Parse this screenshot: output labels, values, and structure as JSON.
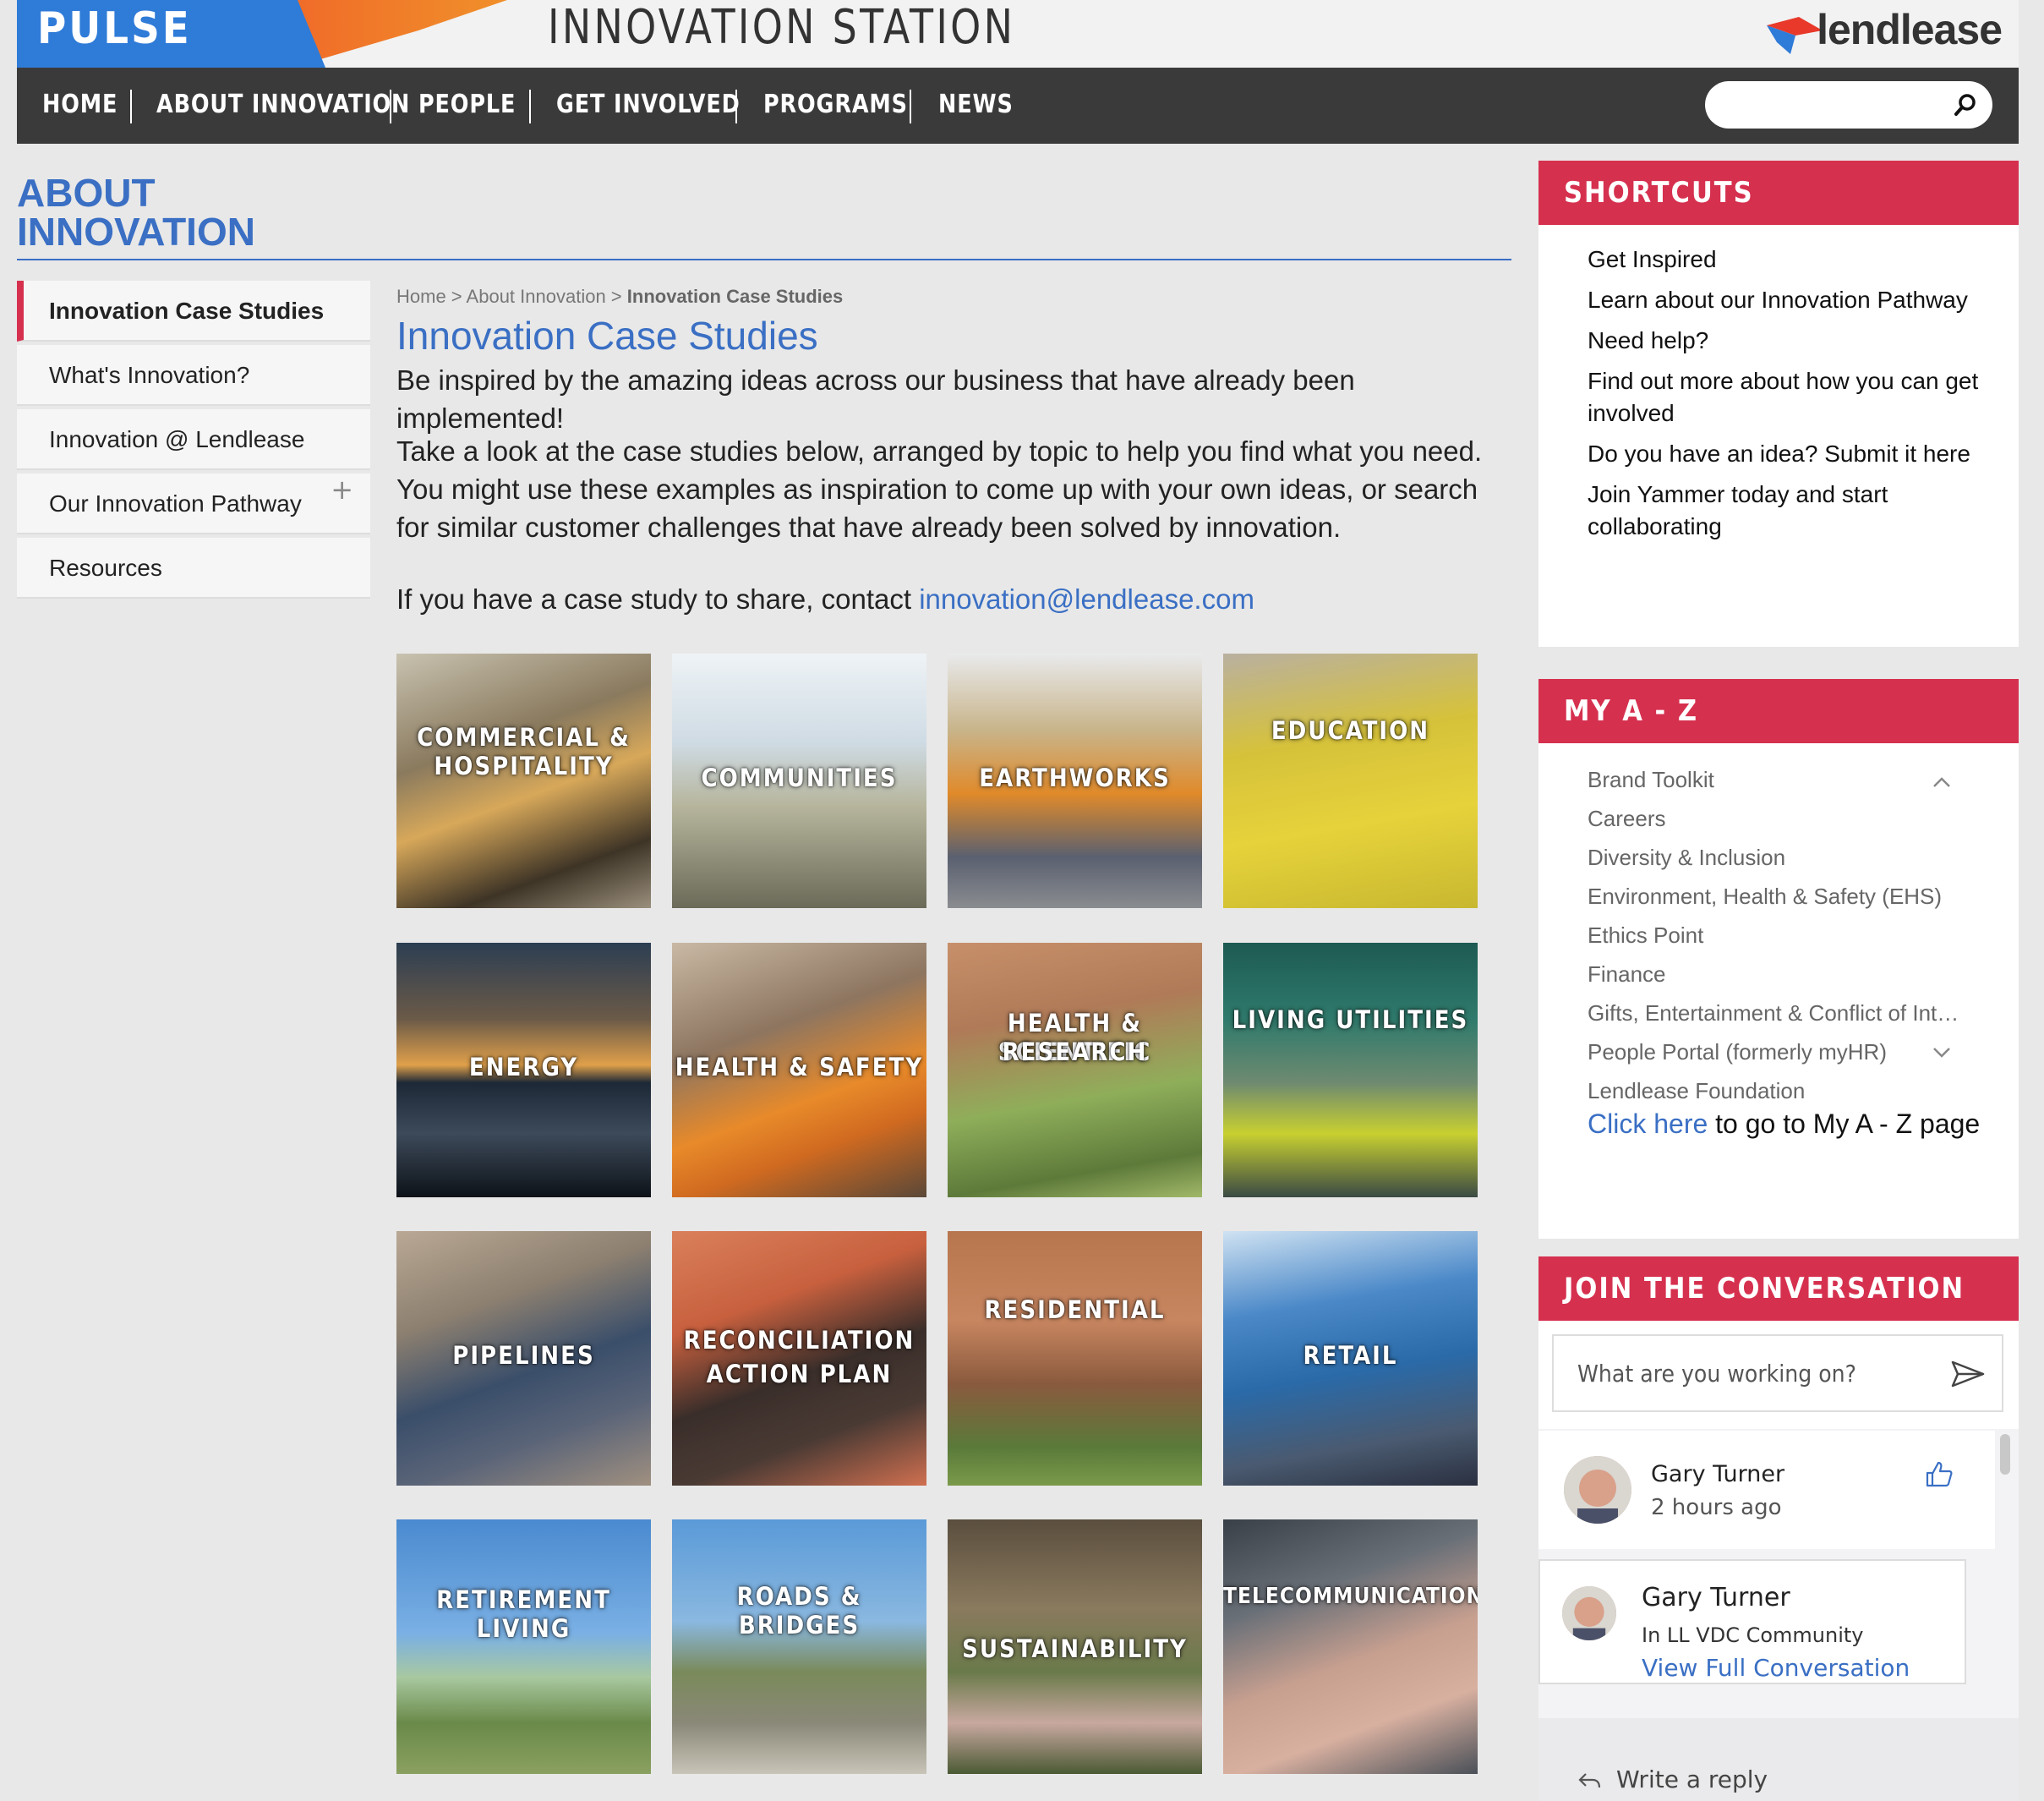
{
  "header": {
    "pulse": "PULSE",
    "site_title": "INNOVATION STATION",
    "brand": "lendlease"
  },
  "nav": {
    "items": [
      "HOME",
      "ABOUT INNOVATION",
      "PEOPLE",
      "GET INVOLVED",
      "PROGRAMS",
      "NEWS"
    ],
    "search_placeholder": ""
  },
  "section": {
    "title_line1": "ABOUT",
    "title_line2": "INNOVATION"
  },
  "leftnav": {
    "items": [
      {
        "label": "Innovation Case Studies",
        "active": true
      },
      {
        "label": "What's Innovation?"
      },
      {
        "label": "Innovation @ Lendlease"
      },
      {
        "label": "Our Innovation Pathway",
        "expand": "+"
      },
      {
        "label": "Resources"
      }
    ]
  },
  "breadcrumb": {
    "home": "Home",
    "sep1": " > ",
    "about": "About Innovation",
    "sep2": " > ",
    "current": "Innovation Case Studies"
  },
  "main": {
    "title": "Innovation Case Studies",
    "intro": "Be inspired by the amazing ideas across our business that have already been implemented!",
    "body": "Take a look at the case studies below, arranged by topic to help you find what you need. You might use these examples as inspiration to come up with your own ideas, or search for similar customer challenges that have already been solved by innovation.",
    "share_prefix": "If you have a case study to share, contact ",
    "share_email": "innovation@lendlease.com"
  },
  "tiles": [
    {
      "line1": "COMMERCIAL &",
      "line2": "HOSPITALITY"
    },
    {
      "line1": "COMMUNITIES",
      "line2": ""
    },
    {
      "line1": "EARTHWORKS",
      "line2": ""
    },
    {
      "line1": "EDUCATION",
      "line2": ""
    },
    {
      "line1": "ENERGY",
      "line2": ""
    },
    {
      "line1": "HEALTH & SAFETY",
      "line2": ""
    },
    {
      "line1": "HEALTH & SCIENTIFIC",
      "line2": "RESEARCH"
    },
    {
      "line1": "LIVING UTILITIES",
      "line2": ""
    },
    {
      "line1": "PIPELINES",
      "line2": ""
    },
    {
      "line1": "RECONCILIATION",
      "line2": "ACTION PLAN"
    },
    {
      "line1": "RESIDENTIAL",
      "line2": ""
    },
    {
      "line1": "RETAIL",
      "line2": ""
    },
    {
      "line1": "RETIREMENT",
      "line2": "LIVING"
    },
    {
      "line1": "ROADS & BRIDGES",
      "line2": ""
    },
    {
      "line1": "SUSTAINABILITY",
      "line2": ""
    },
    {
      "line1": "TELECOMMUNICATIONS",
      "line2": ""
    }
  ],
  "shortcuts": {
    "title": "SHORTCUTS",
    "items": [
      "Get Inspired",
      "Learn about our Innovation Pathway",
      "Need help?",
      "Find out more about how you can get involved",
      "Do you have an idea? Submit it here",
      "Join Yammer today and start collaborating"
    ]
  },
  "az": {
    "title": "MY A - Z",
    "items": [
      "Brand Toolkit",
      "Careers",
      "Diversity & Inclusion",
      "Environment, Health & Safety (EHS)",
      "Ethics Point",
      "Finance",
      "Gifts, Entertainment & Conflict of Int…",
      "People Portal (formerly myHR)",
      "Lendlease Foundation"
    ],
    "link": "Click here",
    "link_suffix": " to go to My A - Z page"
  },
  "conversation": {
    "title": "JOIN THE CONVERSATION",
    "placeholder": "What are you working on?",
    "post_name": "Gary Turner",
    "post_time": "2 hours ago",
    "card_name": "Gary Turner",
    "card_community": "In LL VDC Community",
    "card_link": "View Full Conversation",
    "reply": "Write a reply"
  },
  "colors": {
    "brand_red": "#d6304f",
    "link_blue": "#3a6fc4",
    "nav_dark": "#3a3a3a",
    "pulse_blue": "#2f7bd8",
    "pulse_orange": "#f0642a"
  }
}
